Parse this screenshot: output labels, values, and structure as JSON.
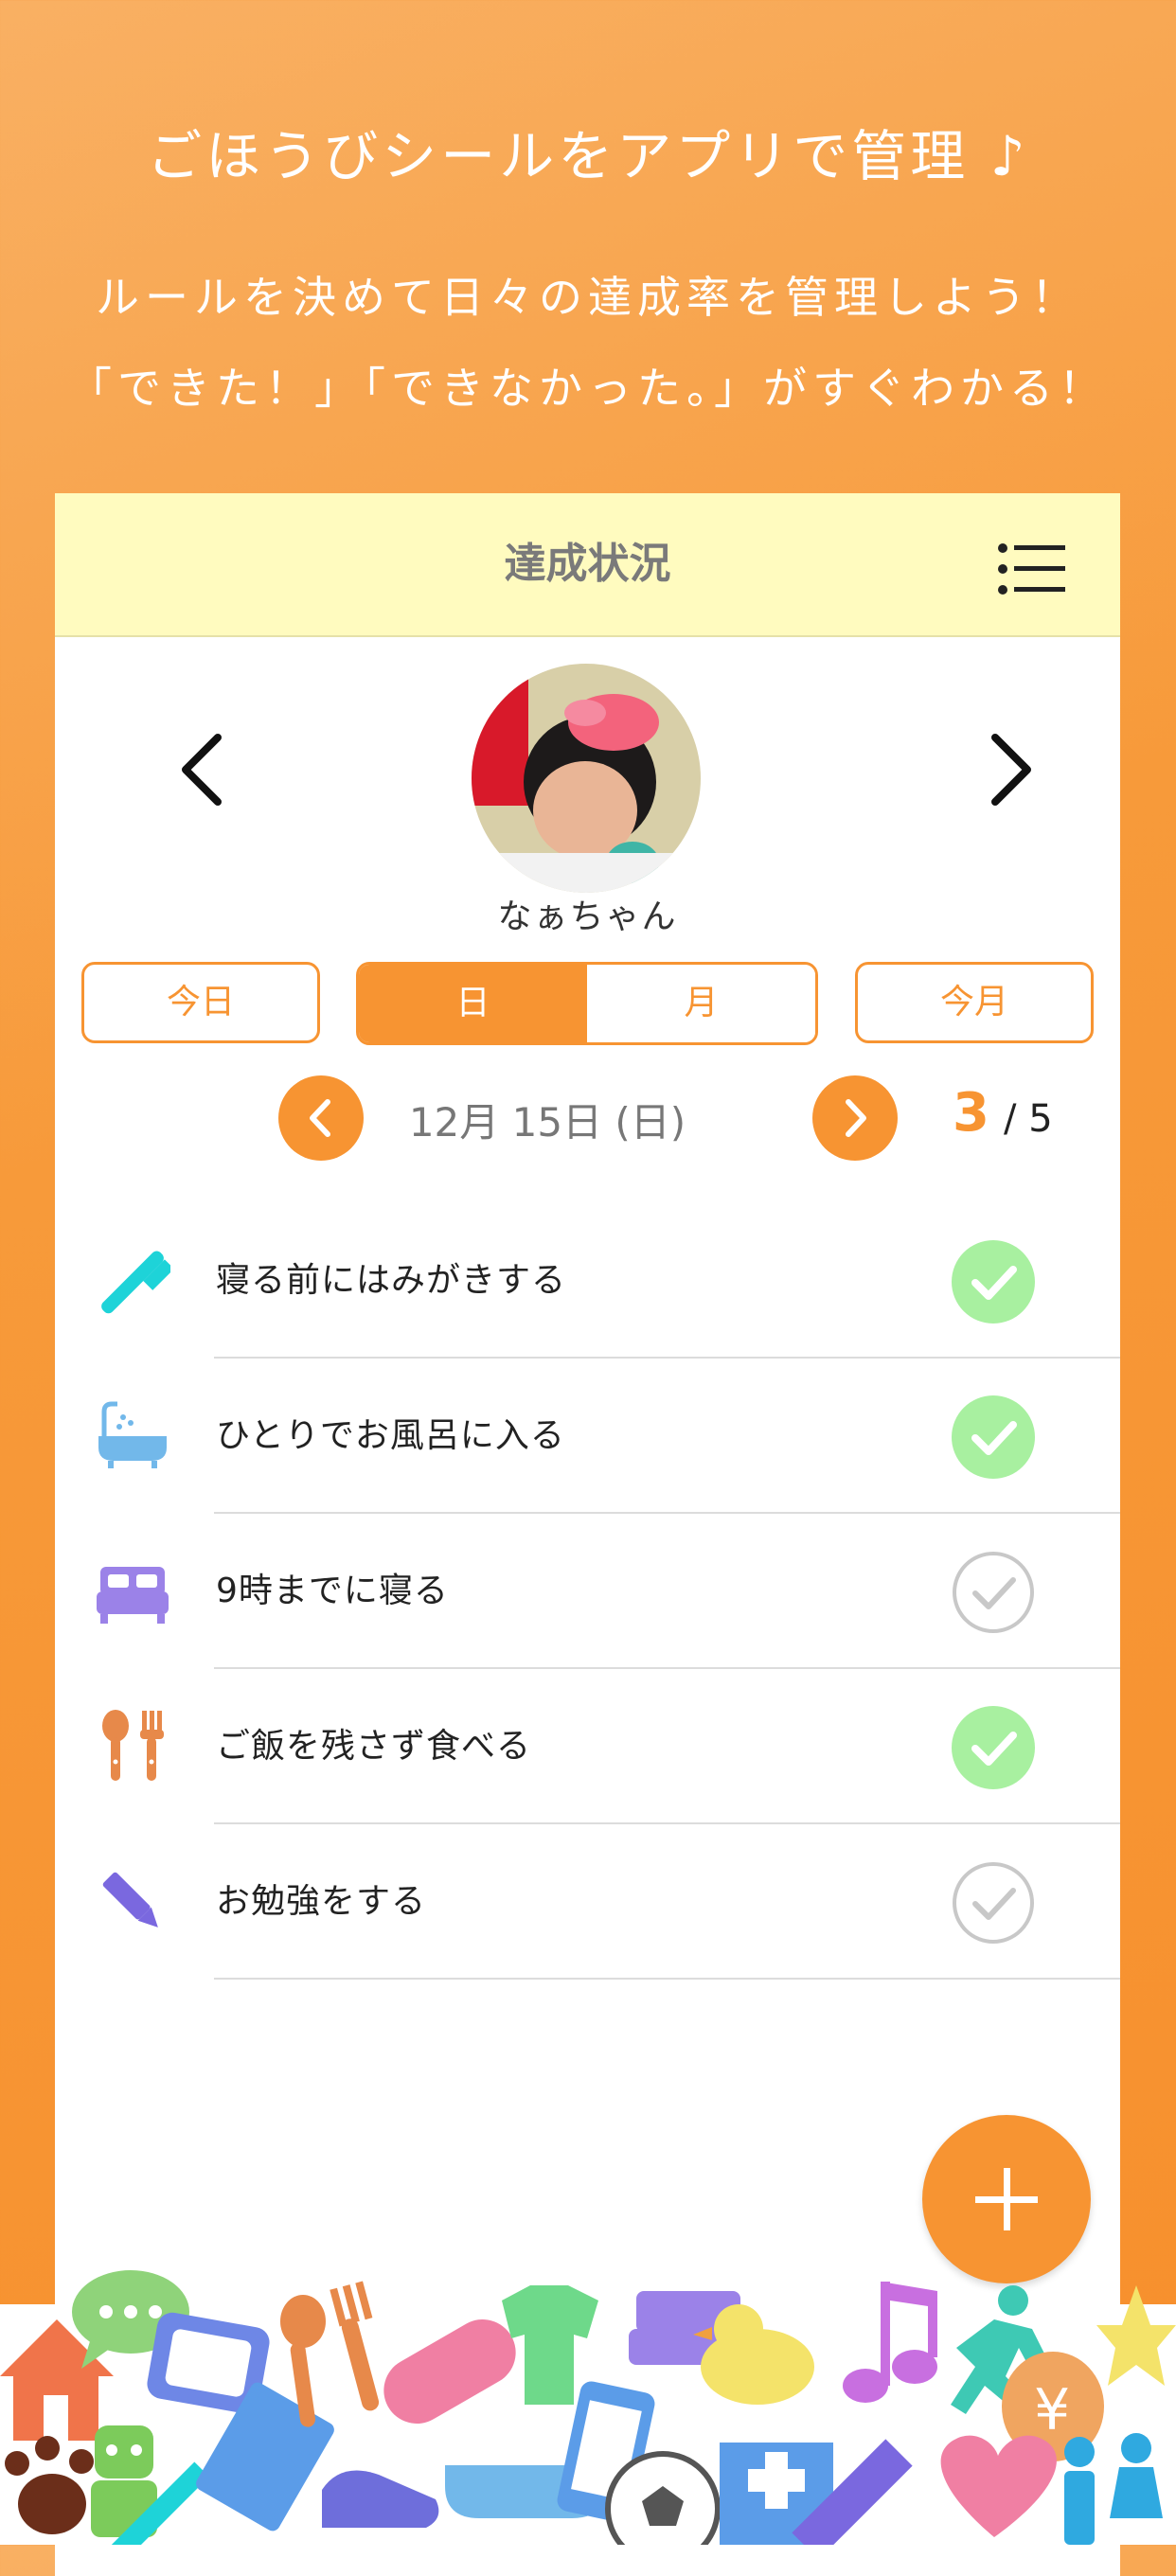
{
  "promo": {
    "headline": "ごほうびシールをアプリで管理 ♪",
    "line1": "ルールを決めて日々の達成率を管理しよう！",
    "line2": "「できた！」「できなかった。」がすぐわかる！"
  },
  "screen": {
    "title": "達成状況",
    "child_name": "なぁちゃん",
    "buttons": {
      "today": "今日",
      "this_month": "今月"
    },
    "segment": {
      "day": "日",
      "month": "月",
      "selected": "日"
    },
    "date": "12月 15日 (日)",
    "achieved": "3",
    "total": "/ 5",
    "tasks": [
      {
        "label": "寝る前にはみがきする",
        "icon": "toothbrush-icon",
        "done": true
      },
      {
        "label": "ひとりでお風呂に入る",
        "icon": "bathtub-icon",
        "done": true
      },
      {
        "label": "9時までに寝る",
        "icon": "bed-icon",
        "done": false
      },
      {
        "label": "ご飯を残さず食べる",
        "icon": "spoon-fork-icon",
        "done": true
      },
      {
        "label": "お勉強をする",
        "icon": "pencil-icon",
        "done": false
      }
    ]
  },
  "colors": {
    "accent": "#f79432",
    "done": "#a8f0a0",
    "navbar": "#fffbbf"
  }
}
